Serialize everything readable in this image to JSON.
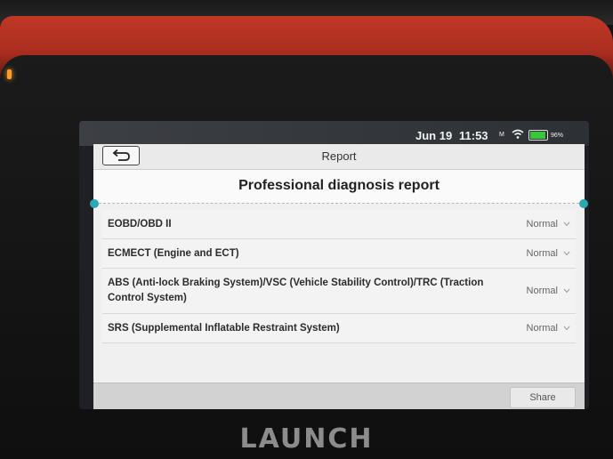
{
  "status_bar": {
    "date": "Jun 19",
    "time": "11:53",
    "network": "M",
    "battery": "96%",
    "battery_color": "#39c53c"
  },
  "header": {
    "title": "Report",
    "back_icon": "back-arrow-icon"
  },
  "report": {
    "heading": "Professional diagnosis report",
    "watermark": "LAUNCH"
  },
  "systems": [
    {
      "name": "EOBD/OBD II",
      "status": "Normal"
    },
    {
      "name": "ECMECT (Engine and ECT)",
      "status": "Normal"
    },
    {
      "name": "ABS (Anti-lock Braking System)/VSC (Vehicle Stability Control)/TRC (Traction Control System)",
      "status": "Normal"
    },
    {
      "name": "SRS (Supplemental Inflatable Restraint System)",
      "status": "Normal"
    }
  ],
  "footer": {
    "share_label": "Share"
  },
  "device": {
    "brand": "LAUNCH",
    "accent_color": "#2ba8b3",
    "case_color": "#c03826"
  }
}
